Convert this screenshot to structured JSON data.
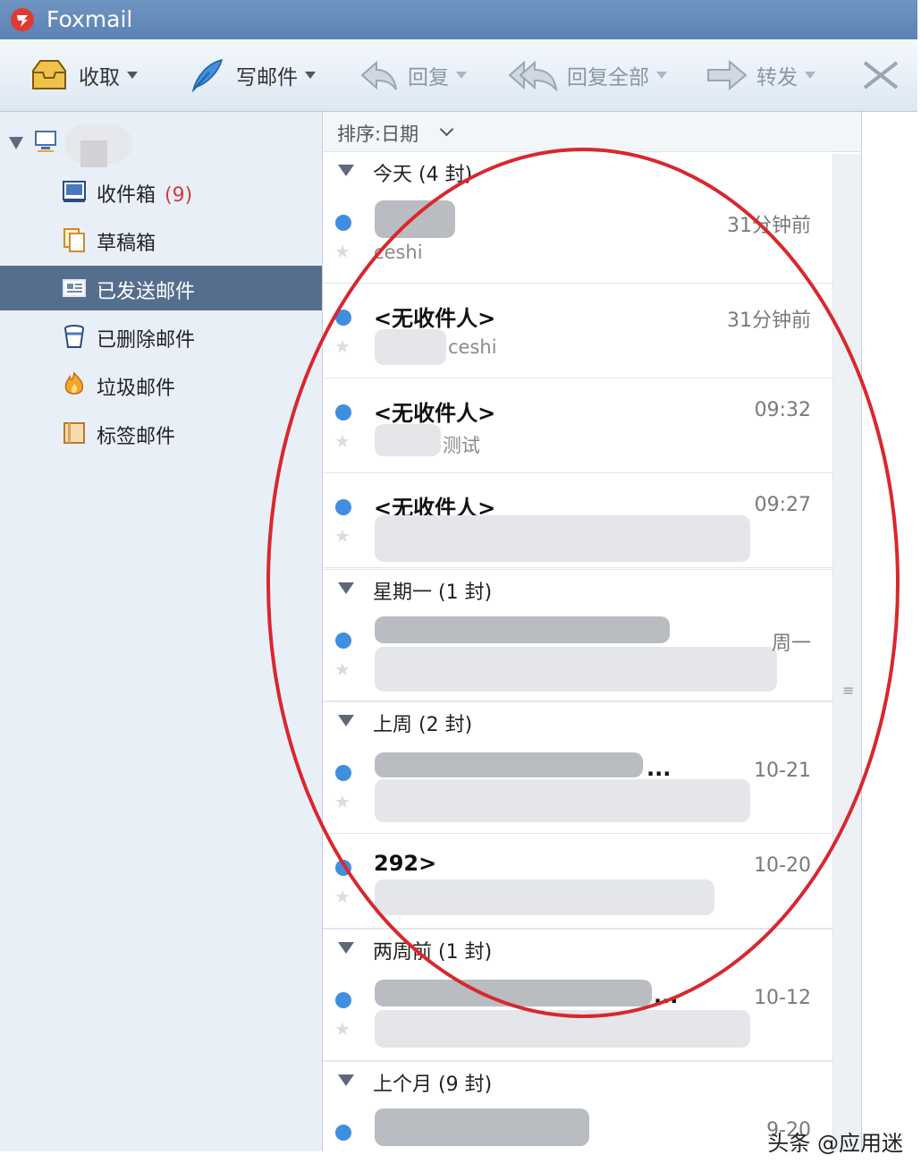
{
  "app": {
    "title": "Foxmail"
  },
  "toolbar": {
    "receive": "收取",
    "compose": "写邮件",
    "reply": "回复",
    "reply_all": "回复全部",
    "forward": "转发"
  },
  "sidebar": {
    "folders": [
      {
        "label": "收件箱",
        "count": "(9)"
      },
      {
        "label": "草稿箱"
      },
      {
        "label": "已发送邮件",
        "selected": true
      },
      {
        "label": "已删除邮件"
      },
      {
        "label": "垃圾邮件"
      },
      {
        "label": "标签邮件"
      }
    ]
  },
  "list": {
    "sort_label": "排序:日期",
    "groups": [
      {
        "label": "今天 (4 封)"
      },
      {
        "label": "星期一 (1 封)"
      },
      {
        "label": "上周 (2 封)"
      },
      {
        "label": "两周前 (1 封)"
      },
      {
        "label": "上个月 (9 封)"
      }
    ],
    "mails": [
      {
        "sender": "",
        "subject": "ceshi",
        "date": "31分钟前"
      },
      {
        "sender": "<无收件人>",
        "subject": "ceshi",
        "date": "31分钟前"
      },
      {
        "sender": "<无收件人>",
        "subject": "测试",
        "date": "09:32"
      },
      {
        "sender": "<无收件人>",
        "subject": "",
        "date": "09:27"
      },
      {
        "sender": "",
        "subject": "",
        "date": "周一"
      },
      {
        "sender": "...",
        "subject": "",
        "date": "10-21"
      },
      {
        "sender": "292>",
        "subject": "",
        "date": "10-20"
      },
      {
        "sender": "...",
        "subject": "",
        "date": "10-12"
      },
      {
        "sender": "",
        "subject": "",
        "date": "9-20"
      }
    ]
  },
  "watermark": "头条 @应用迷",
  "colors": {
    "selected_folder": "#566e8e",
    "unread_dot": "#3f8ee0",
    "annotation_circle": "#d9272e",
    "count_red": "#d43a3a"
  },
  "icons": {
    "toolbar": [
      "inbox-tray-icon",
      "feather-pen-icon",
      "reply-arrow-icon",
      "reply-all-arrow-icon",
      "forward-arrow-icon"
    ],
    "folders": [
      "inbox-icon",
      "drafts-icon",
      "sent-icon",
      "trash-icon",
      "spam-flame-icon",
      "tag-icon"
    ]
  }
}
